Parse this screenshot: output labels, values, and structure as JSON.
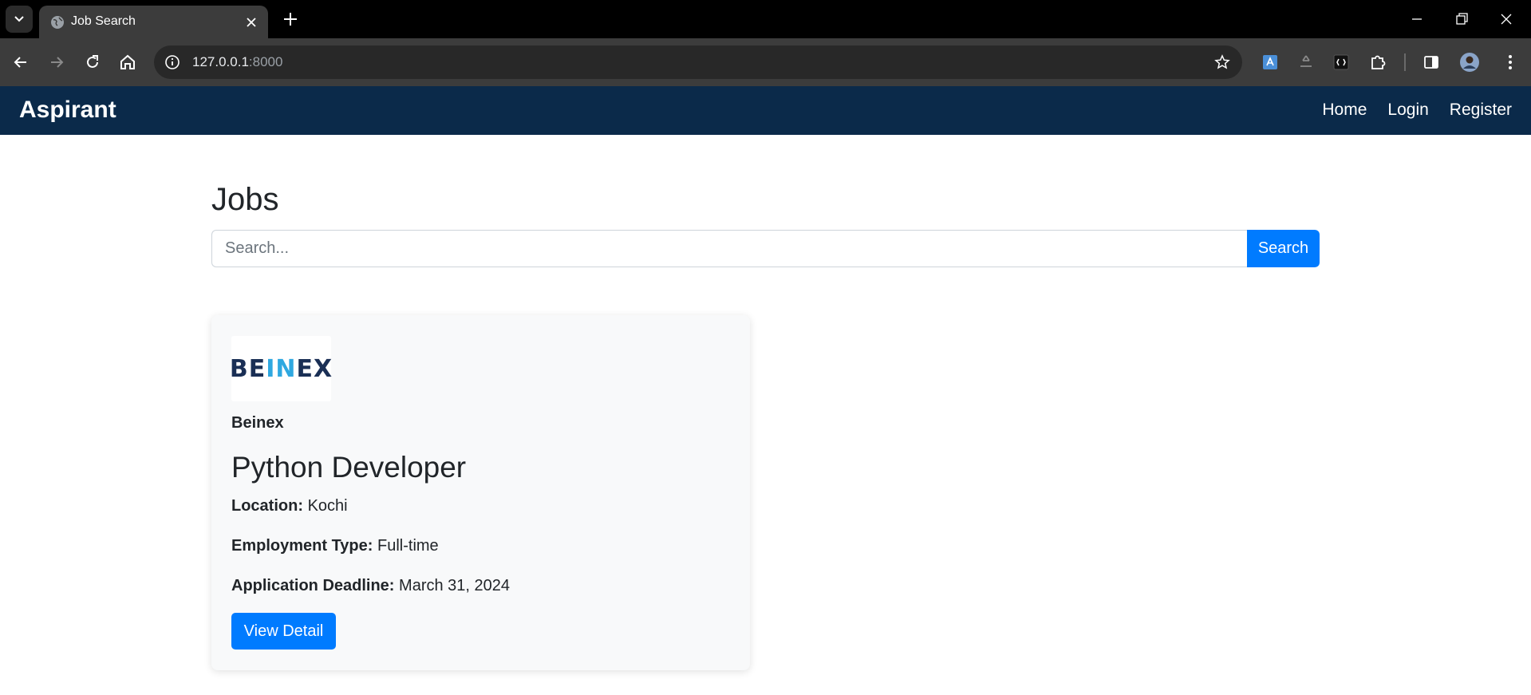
{
  "browser": {
    "tab_title": "Job Search",
    "url_host": "127.0.0.1",
    "url_port": ":8000"
  },
  "navbar": {
    "brand": "Aspirant",
    "links": [
      "Home",
      "Login",
      "Register"
    ],
    "background_color": "#0b2a4a"
  },
  "main": {
    "title": "Jobs",
    "search": {
      "placeholder": "Search...",
      "value": "",
      "button_label": "Search"
    },
    "jobs": [
      {
        "logo_text_dark_1": "BE",
        "logo_text_accent": "IN",
        "logo_text_dark_2": "EX",
        "company": "Beinex",
        "title": "Python Developer",
        "location_label": "Location:",
        "location": "Kochi",
        "employment_type_label": "Employment Type:",
        "employment_type": "Full-time",
        "deadline_label": "Application Deadline:",
        "deadline": "March 31, 2024",
        "button_label": "View Detail"
      }
    ]
  },
  "colors": {
    "primary": "#007bff",
    "card_bg": "#f8f9fa"
  }
}
